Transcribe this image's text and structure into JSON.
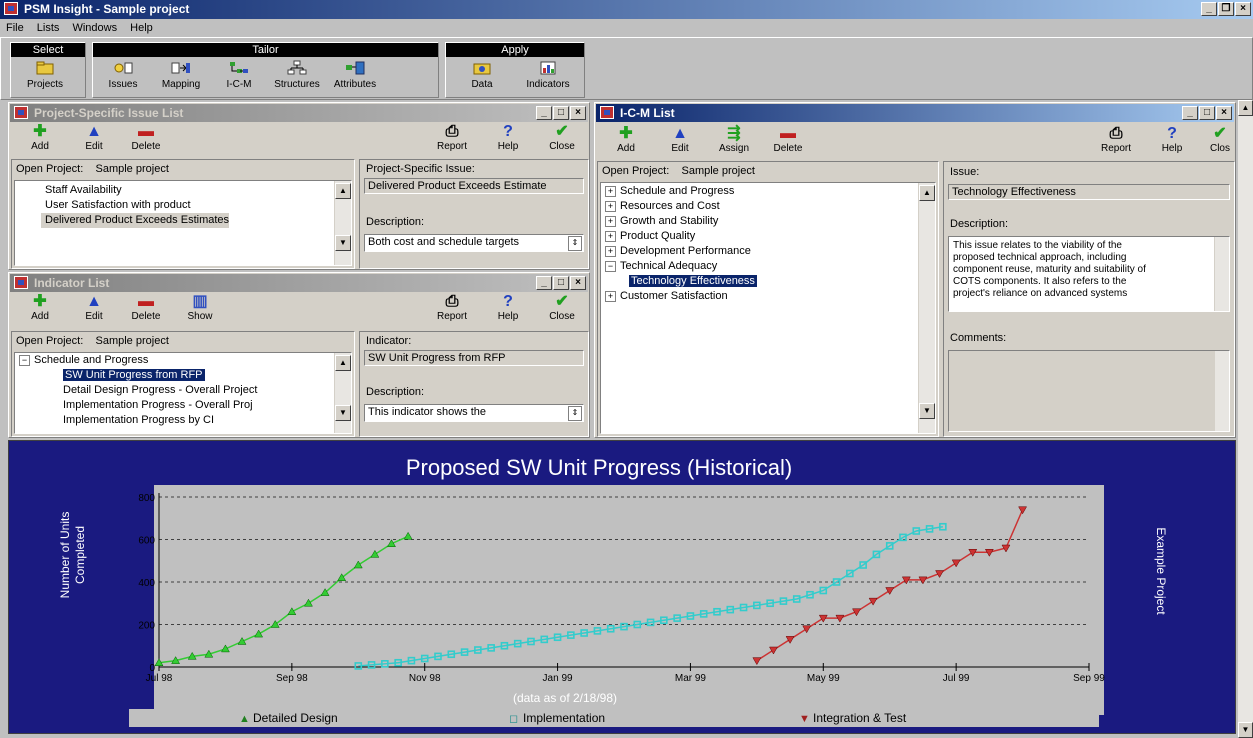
{
  "app": {
    "title": "PSM Insight - Sample project"
  },
  "menu": [
    "File",
    "Lists",
    "Windows",
    "Help"
  ],
  "toolbar": {
    "groups": {
      "select": "Select",
      "tailor": "Tailor",
      "apply": "Apply"
    },
    "buttons": {
      "projects": "Projects",
      "issues": "Issues",
      "mapping": "Mapping",
      "icm": "I-C-M",
      "structures": "Structures",
      "attributes": "Attributes",
      "data": "Data",
      "indicators": "Indicators"
    }
  },
  "issue_window": {
    "title": "Project-Specific Issue List",
    "add": "Add",
    "edit": "Edit",
    "delete": "Delete",
    "report": "Report",
    "help": "Help",
    "close": "Close",
    "open_project_label": "Open Project:",
    "open_project_value": "Sample project",
    "items": [
      "Staff Availability",
      "User Satisfaction with product",
      "Delivered Product Exceeds Estimates"
    ],
    "issue_label": "Project-Specific Issue:",
    "issue_value": "Delivered Product Exceeds Estimate",
    "description_label": "Description:",
    "description_value": "Both cost and schedule targets"
  },
  "indicator_window": {
    "title": "Indicator List",
    "add": "Add",
    "edit": "Edit",
    "delete": "Delete",
    "show": "Show",
    "report": "Report",
    "help": "Help",
    "close": "Close",
    "open_project_label": "Open Project:",
    "open_project_value": "Sample project",
    "tree_root": "Schedule and Progress",
    "items": [
      "SW Unit Progress from RFP",
      "Detail Design Progress - Overall Project",
      "Implementation Progress - Overall Proj",
      "Implementation Progress by CI"
    ],
    "indicator_label": "Indicator:",
    "indicator_value": "SW Unit Progress from RFP",
    "description_label": "Description:",
    "description_value": "This indicator shows the"
  },
  "icm_window": {
    "title": "I-C-M List",
    "add": "Add",
    "edit": "Edit",
    "assign": "Assign",
    "delete": "Delete",
    "report": "Report",
    "help": "Help",
    "close": "Clos",
    "open_project_label": "Open Project:",
    "open_project_value": "Sample project",
    "tree": [
      {
        "label": "Schedule and Progress",
        "type": "plus"
      },
      {
        "label": "Resources and Cost",
        "type": "plus"
      },
      {
        "label": "Growth and Stability",
        "type": "plus"
      },
      {
        "label": "Product Quality",
        "type": "plus"
      },
      {
        "label": "Development Performance",
        "type": "plus"
      },
      {
        "label": "Technical Adequacy",
        "type": "minus"
      },
      {
        "label": "Technology Effectiveness",
        "type": "child"
      },
      {
        "label": "Customer Satisfaction",
        "type": "plus"
      }
    ],
    "issue_label": "Issue:",
    "issue_value": "Technology Effectiveness",
    "description_label": "Description:",
    "description_lines": [
      "This issue relates to the viability of the",
      "proposed technical approach, including",
      "component reuse, maturity and suitability of",
      "COTS components. It also refers to the",
      "project's reliance on advanced systems"
    ],
    "comments_label": "Comments:"
  },
  "chart_data": {
    "type": "line",
    "title": "Proposed SW Unit Progress (Historical)",
    "ylabel": [
      "Number of Units",
      "Completed"
    ],
    "right_label": "Example Project",
    "note": "(data as of 2/18/98)",
    "ylim": [
      0,
      800
    ],
    "yticks": [
      0,
      200,
      400,
      600,
      800
    ],
    "xlim": [
      0,
      14.0
    ],
    "xticks": [
      {
        "v": 0,
        "label": "Jul 98"
      },
      {
        "v": 2,
        "label": "Sep 98"
      },
      {
        "v": 4,
        "label": "Nov 98"
      },
      {
        "v": 6,
        "label": "Jan 99"
      },
      {
        "v": 8,
        "label": "Mar 99"
      },
      {
        "v": 10,
        "label": "May 99"
      },
      {
        "v": 12,
        "label": "Jul 99"
      },
      {
        "v": 14,
        "label": "Sep 99"
      }
    ],
    "grid": true,
    "legend_position": "bottom",
    "series": [
      {
        "name": "Detailed Design",
        "marker": "triangle",
        "color": "#33cc33",
        "x": [
          0,
          0.25,
          0.5,
          0.75,
          1.0,
          1.25,
          1.5,
          1.75,
          2.0,
          2.25,
          2.5,
          2.75,
          3.0,
          3.25,
          3.5,
          3.75
        ],
        "y": [
          20,
          30,
          50,
          60,
          85,
          120,
          155,
          200,
          260,
          300,
          350,
          420,
          480,
          530,
          580,
          615
        ]
      },
      {
        "name": "Implementation",
        "marker": "square",
        "color": "#33cccc",
        "x": [
          3.0,
          3.2,
          3.4,
          3.6,
          3.8,
          4.0,
          4.2,
          4.4,
          4.6,
          4.8,
          5.0,
          5.2,
          5.4,
          5.6,
          5.8,
          6.0,
          6.2,
          6.4,
          6.6,
          6.8,
          7.0,
          7.2,
          7.4,
          7.6,
          7.8,
          8.0,
          8.2,
          8.4,
          8.6,
          8.8,
          9.0,
          9.2,
          9.4,
          9.6,
          9.8,
          10.0,
          10.2,
          10.4,
          10.6,
          10.8,
          11.0,
          11.2,
          11.4,
          11.6,
          11.8
        ],
        "y": [
          5,
          10,
          15,
          20,
          30,
          40,
          50,
          60,
          70,
          80,
          90,
          100,
          110,
          120,
          130,
          140,
          150,
          160,
          170,
          180,
          190,
          200,
          210,
          220,
          230,
          240,
          250,
          260,
          270,
          280,
          290,
          300,
          310,
          320,
          340,
          360,
          400,
          440,
          480,
          530,
          570,
          610,
          640,
          650,
          660
        ]
      },
      {
        "name": "Integration & Test",
        "marker": "inverted-triangle",
        "color": "#cc3333",
        "x": [
          9.0,
          9.25,
          9.5,
          9.75,
          10.0,
          10.25,
          10.5,
          10.75,
          11.0,
          11.25,
          11.5,
          11.75,
          12.0,
          12.25,
          12.5,
          12.75,
          13.0
        ],
        "y": [
          30,
          80,
          130,
          180,
          230,
          230,
          260,
          310,
          360,
          410,
          410,
          440,
          490,
          540,
          540,
          560,
          740
        ]
      }
    ]
  }
}
